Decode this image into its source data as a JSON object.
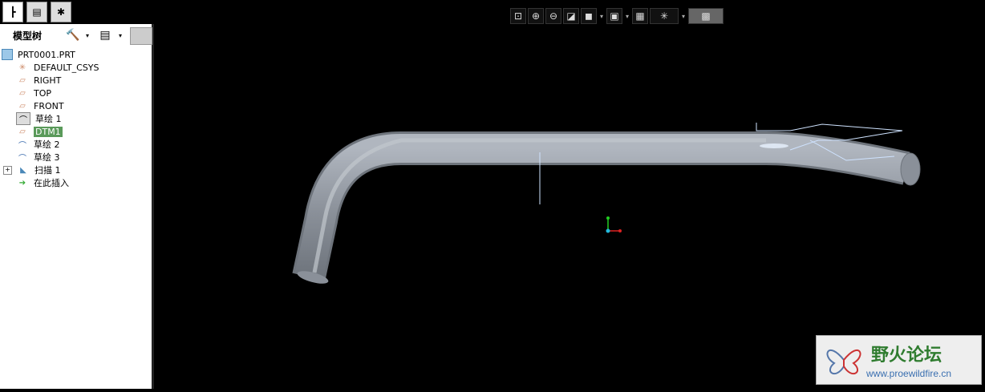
{
  "tabs": [
    {
      "icon": "model-tree-icon"
    },
    {
      "icon": "folder-browser-icon"
    },
    {
      "icon": "favorites-icon"
    }
  ],
  "panel": {
    "title": "模型树",
    "tree": [
      {
        "label": "PRT0001.PRT",
        "icon": "part-icon"
      },
      {
        "label": "DEFAULT_CSYS",
        "icon": "csys-icon"
      },
      {
        "label": "RIGHT",
        "icon": "datum-plane-icon"
      },
      {
        "label": "TOP",
        "icon": "datum-plane-icon"
      },
      {
        "label": "FRONT",
        "icon": "datum-plane-icon"
      },
      {
        "label": "草绘 1",
        "icon": "sketch-icon"
      },
      {
        "label": "DTM1",
        "icon": "datum-plane-icon",
        "selected": true
      },
      {
        "label": "草绘 2",
        "icon": "sketch-icon"
      },
      {
        "label": "草绘 3",
        "icon": "sketch-icon"
      },
      {
        "label": "扫描 1",
        "icon": "sweep-icon",
        "expandable": true
      },
      {
        "label": "在此插入",
        "icon": "insert-here-arrow-icon"
      }
    ]
  },
  "toolbar": [
    "zoom-fit-icon",
    "zoom-in-icon",
    "zoom-out-icon",
    "repaint-icon",
    "shading-icon",
    "saved-views-icon",
    "view-manager-icon",
    "datum-display-icon",
    "display-style-icon"
  ],
  "logo": {
    "name": "野火论坛",
    "url": "www.proewildfire.cn"
  },
  "colors": {
    "selection": "#5a9a5a",
    "background": "#000000",
    "pipe": "#8a9099"
  }
}
